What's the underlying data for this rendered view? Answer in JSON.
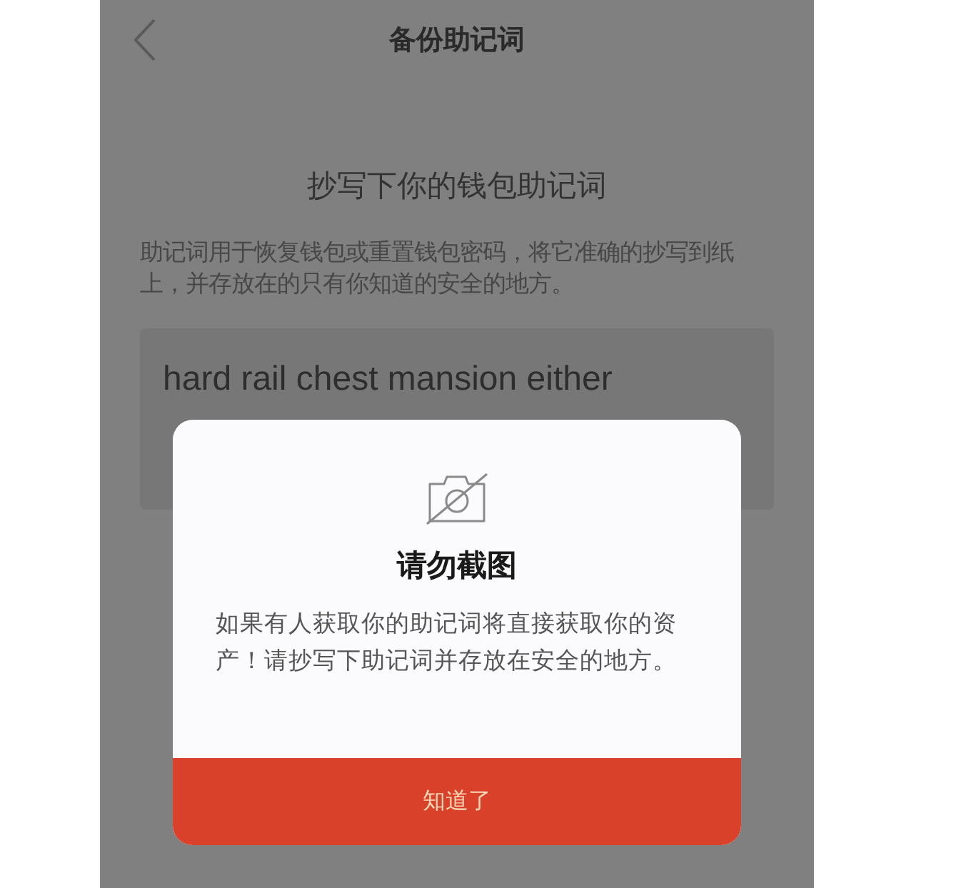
{
  "nav": {
    "title": "备份助记词"
  },
  "heading": "抄写下你的钱包助记词",
  "description": "助记词用于恢复钱包或重置钱包密码，将它准确的抄写到纸上，并存放在的只有你知道的安全的地方。",
  "mnemonic": "hard rail chest mansion either",
  "dialog": {
    "title": "请勿截图",
    "message": "如果有人获取你的助记词将直接获取你的资产！请抄写下助记词并存放在安全的地方。",
    "button": "知道了"
  }
}
